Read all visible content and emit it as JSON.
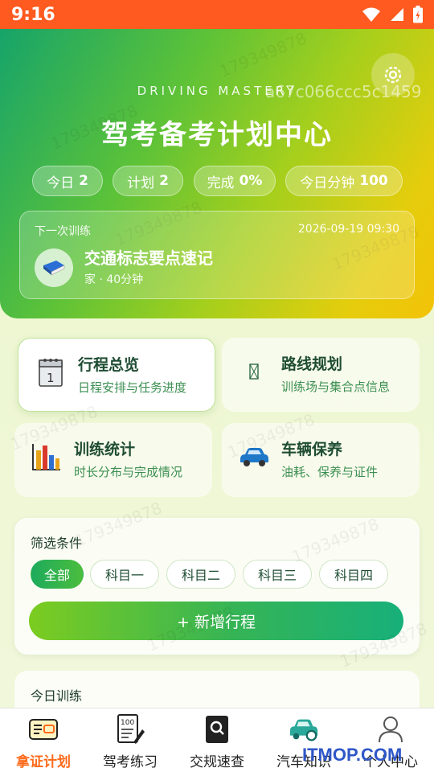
{
  "status": {
    "time": "9:16"
  },
  "hero": {
    "eyebrow": "DRIVING MASTERY",
    "hash": "a67c066ccc5c1459",
    "title": "驾考备考计划中心",
    "stats": [
      {
        "label": "今日",
        "value": "2"
      },
      {
        "label": "计划",
        "value": "2"
      },
      {
        "label": "完成",
        "value": "0%"
      },
      {
        "label": "今日分钟",
        "value": "100"
      }
    ],
    "next": {
      "label": "下一次训练",
      "time": "2026-09-19 09:30",
      "title": "交通标志要点速记",
      "meta": "家 · 40分钟"
    }
  },
  "features": [
    {
      "title": "行程总览",
      "sub": "日程安排与任务进度",
      "icon": "calendar-icon"
    },
    {
      "title": "路线规划",
      "sub": "训练场与集合点信息",
      "icon": "map-icon"
    },
    {
      "title": "训练统计",
      "sub": "时长分布与完成情况",
      "icon": "bar-chart-icon"
    },
    {
      "title": "车辆保养",
      "sub": "油耗、保养与证件",
      "icon": "car-icon"
    }
  ],
  "filter": {
    "title": "筛选条件",
    "chips": [
      "全部",
      "科目一",
      "科目二",
      "科目三",
      "科目四"
    ],
    "selected": "全部",
    "add_label": "+ 新增行程"
  },
  "today": {
    "title": "今日训练"
  },
  "nav": [
    {
      "label": "拿证计划",
      "icon": "license-icon"
    },
    {
      "label": "驾考练习",
      "icon": "exam-paper-icon"
    },
    {
      "label": "交规速查",
      "icon": "search-book-icon"
    },
    {
      "label": "汽车知识",
      "icon": "car-search-icon"
    },
    {
      "label": "个人中心",
      "icon": "user-icon"
    }
  ],
  "watermark": "179349878",
  "site_mark": "ITMOP.COM",
  "colors": {
    "accent": "#ff6a1a",
    "green": "#1dab5c",
    "status_bar": "#ff5a1f"
  }
}
